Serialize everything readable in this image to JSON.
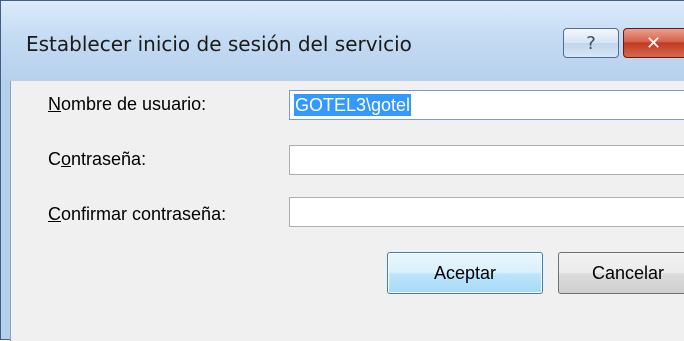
{
  "window": {
    "title": "Establecer inicio de sesión del servicio",
    "help_glyph": "?",
    "close_glyph": "✕"
  },
  "form": {
    "username": {
      "label_prefix": "",
      "label_accel": "N",
      "label_rest": "ombre de usuario:",
      "value": "GOTEL3\\gotel"
    },
    "password": {
      "label_prefix": "C",
      "label_accel": "o",
      "label_rest": "ntraseña:",
      "value": ""
    },
    "confirm": {
      "label_prefix": "",
      "label_accel": "C",
      "label_rest": "onfirmar contraseña:",
      "value": ""
    }
  },
  "buttons": {
    "ok_label": "Aceptar",
    "cancel_label": "Cancelar"
  }
}
